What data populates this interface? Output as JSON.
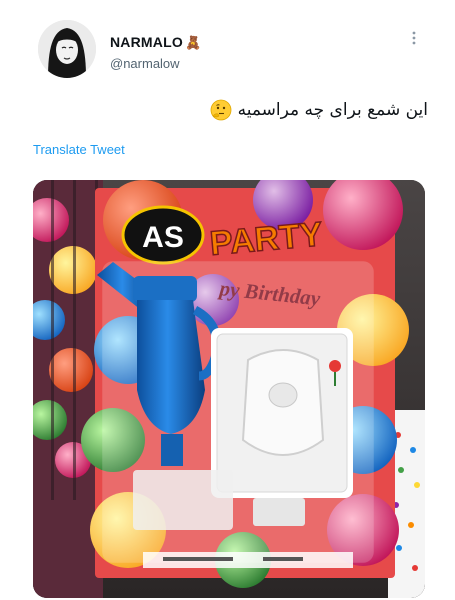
{
  "tweet": {
    "display_name": "NARMALO",
    "name_emoji": "bear-face-icon",
    "handle": "@narmalow",
    "text": "این شمع برای چه مراسمیه",
    "text_emoji": "thinking-face-icon",
    "translate_label": "Translate Tweet"
  },
  "media": {
    "package_brand": "AS",
    "package_title": "PARTY",
    "package_subtitle": "py Birthday"
  },
  "colors": {
    "link": "#1d9bf0",
    "handle": "#536471",
    "text": "#0f1419",
    "candle_blue": "#1d72c9"
  }
}
